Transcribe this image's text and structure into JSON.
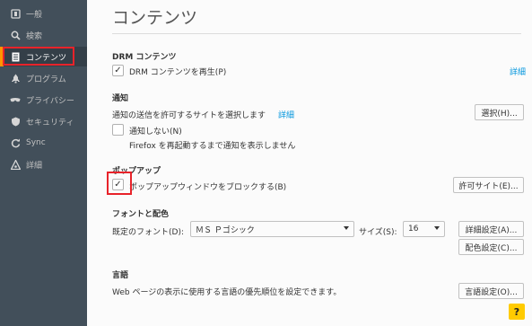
{
  "sidebar": {
    "items": [
      {
        "label": "一般",
        "icon": "general-icon"
      },
      {
        "label": "検索",
        "icon": "search-icon"
      },
      {
        "label": "コンテンツ",
        "icon": "content-icon"
      },
      {
        "label": "プログラム",
        "icon": "applications-icon"
      },
      {
        "label": "プライバシー",
        "icon": "privacy-icon"
      },
      {
        "label": "セキュリティ",
        "icon": "security-icon"
      },
      {
        "label": "Sync",
        "icon": "sync-icon"
      },
      {
        "label": "詳細",
        "icon": "advanced-icon"
      }
    ],
    "active_index": 2
  },
  "page": {
    "title": "コンテンツ"
  },
  "drm": {
    "heading": "DRM コンテンツ",
    "checkbox_label": "DRM コンテンツを再生(P)",
    "checked": true,
    "details_link": "詳細"
  },
  "notifications": {
    "heading": "通知",
    "description": "通知の送信を許可するサイトを選択します",
    "details_link": "詳細",
    "choose_button": "選択(H)...",
    "dnd_label": "通知しない(N)",
    "dnd_checked": false,
    "dnd_note": "Firefox を再起動するまで通知を表示しません"
  },
  "popups": {
    "heading": "ポップアップ",
    "block_label": "ポップアップウィンドウをブロックする(B)",
    "block_checked": true,
    "exceptions_button": "許可サイト(E)..."
  },
  "fonts": {
    "heading": "フォントと配色",
    "default_font_label": "既定のフォント(D):",
    "default_font_value": "ＭＳ Ｐゴシック",
    "size_label": "サイズ(S):",
    "size_value": "16",
    "advanced_button": "詳細設定(A)...",
    "colors_button": "配色設定(C)..."
  },
  "languages": {
    "heading": "言語",
    "description": "Web ページの表示に使用する言語の優先順位を設定できます。",
    "choose_button": "言語設定(O)..."
  },
  "help": {
    "label": "?"
  },
  "colors": {
    "sidebar_bg": "#424f5a",
    "accent": "#ff9500",
    "link": "#0095dd",
    "highlight": "#e8232a",
    "help_bg": "#ffcb00"
  }
}
